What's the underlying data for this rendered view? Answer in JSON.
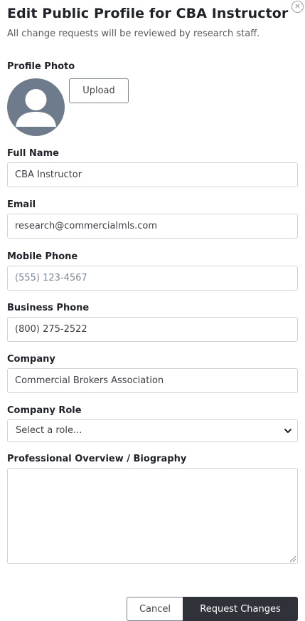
{
  "header": {
    "title": "Edit Public Profile for CBA Instructor",
    "subtitle": "All change requests will be reviewed by research staff.",
    "close_icon": "close-circle-icon"
  },
  "photo": {
    "label": "Profile Photo",
    "avatar_icon": "user-avatar-icon",
    "upload_label": "Upload",
    "avatar_color": "#6d7b8c"
  },
  "fields": {
    "full_name": {
      "label": "Full Name",
      "value": "CBA Instructor",
      "placeholder": ""
    },
    "email": {
      "label": "Email",
      "value": "research@commercialmls.com",
      "placeholder": ""
    },
    "mobile_phone": {
      "label": "Mobile Phone",
      "value": "",
      "placeholder": "(555) 123-4567"
    },
    "business_phone": {
      "label": "Business Phone",
      "value": "(800) 275-2522",
      "placeholder": ""
    },
    "company": {
      "label": "Company",
      "value": "Commercial Brokers Association",
      "placeholder": ""
    },
    "company_role": {
      "label": "Company Role",
      "selected": "Select a role..."
    },
    "biography": {
      "label": "Professional Overview / Biography",
      "value": ""
    }
  },
  "actions": {
    "cancel_label": "Cancel",
    "submit_label": "Request Changes",
    "submit_color": "#2f3339"
  }
}
